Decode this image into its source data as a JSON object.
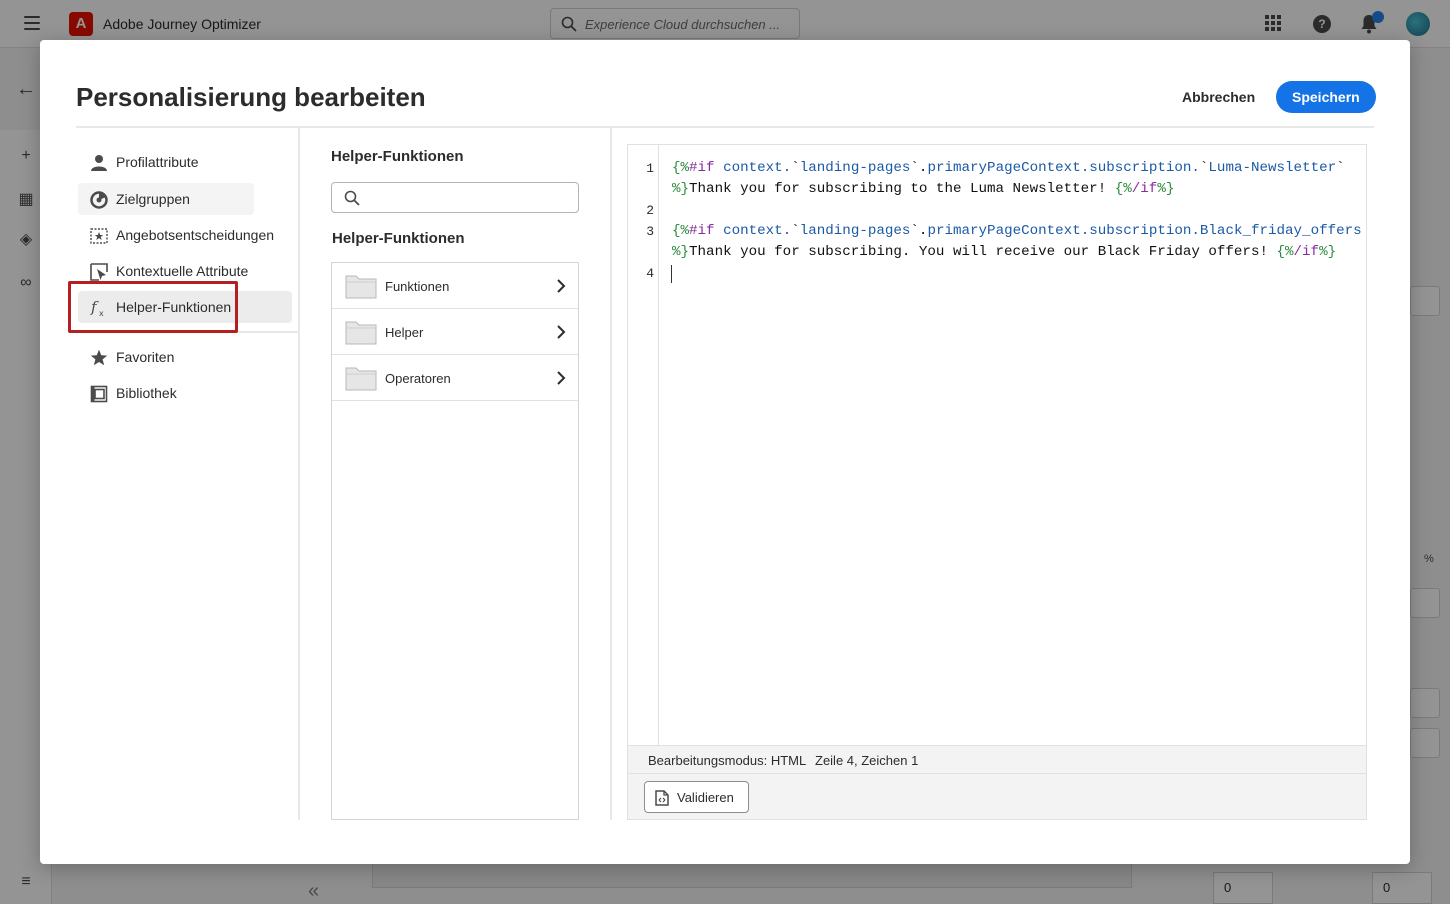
{
  "app": {
    "name": "Adobe Journey Optimizer",
    "logo_letter": "A",
    "search_placeholder": "Experience Cloud durchsuchen ...",
    "help_glyph": "?"
  },
  "modal": {
    "title": "Personalisierung bearbeiten",
    "cancel_label": "Abbrechen",
    "save_label": "Speichern"
  },
  "leftnav": {
    "items": [
      {
        "label": "Profilattribute",
        "icon": "user-icon"
      },
      {
        "label": "Zielgruppen",
        "icon": "audience-icon"
      },
      {
        "label": "Angebotsentscheidungen",
        "icon": "offer-decision-icon"
      },
      {
        "label": "Kontextuelle Attribute",
        "icon": "contextual-attributes-icon"
      },
      {
        "label": "Helper-Funktionen",
        "icon": "function-icon"
      },
      {
        "label": "Favoriten",
        "icon": "star-icon"
      },
      {
        "label": "Bibliothek",
        "icon": "library-icon"
      }
    ],
    "collapse_glyph": "«"
  },
  "middle": {
    "title": "Helper-Funktionen",
    "search_placeholder": "",
    "subtitle": "Helper-Funktionen",
    "folders": [
      {
        "label": "Funktionen",
        "icon": "folder-icon"
      },
      {
        "label": "Helper",
        "icon": "folder-icon"
      },
      {
        "label": "Operatoren",
        "icon": "folder-icon"
      }
    ]
  },
  "editor": {
    "line_numbers": [
      "1",
      "2",
      "3",
      "4"
    ],
    "status_mode": "Bearbeitungsmodus: HTML",
    "status_position": "Zeile 4, Zeichen 1",
    "validate_label": "Validieren"
  },
  "background": {
    "footer_field_1": "0",
    "footer_field_2": "0",
    "percent_glyph": "%"
  },
  "colors": {
    "accent": "#1473e6",
    "highlight_box": "#b41f1f",
    "brand_red": "#eb1000"
  }
}
